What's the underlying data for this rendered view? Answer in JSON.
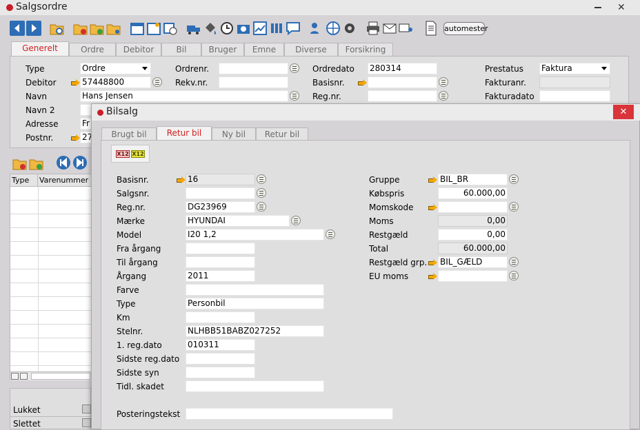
{
  "main_window": {
    "title": "Salgsordre",
    "toolbar": {
      "automester_label": "automester"
    },
    "tabs": [
      {
        "label": "Generelt",
        "active": true
      },
      {
        "label": "Ordre"
      },
      {
        "label": "Debitor"
      },
      {
        "label": "Bil"
      },
      {
        "label": "Bruger"
      },
      {
        "label": "Emne"
      },
      {
        "label": "Diverse"
      },
      {
        "label": "Forsikring"
      }
    ],
    "form": {
      "type_label": "Type",
      "type_value": "Ordre",
      "debitor_label": "Debitor",
      "debitor_value": "57448800",
      "navn_label": "Navn",
      "navn_value": "Hans Jensen",
      "navn2_label": "Navn 2",
      "navn2_value": "",
      "adresse_label": "Adresse",
      "adresse_value": "Fr",
      "postnr_label": "Postnr.",
      "postnr_value": "27",
      "ordrenr_label": "Ordrenr.",
      "ordrenr_value": "",
      "rekvnr_label": "Rekv.nr.",
      "rekvnr_value": "",
      "ordredato_label": "Ordredato",
      "ordredato_value": "280314",
      "basisnr_label": "Basisnr.",
      "basisnr_value": "",
      "regnr_label": "Reg.nr.",
      "regnr_value": "",
      "prestatus_label": "Prestatus",
      "prestatus_value": "Faktura",
      "fakturanr_label": "Fakturanr.",
      "fakturanr_value": "",
      "fakturadato_label": "Fakturadato",
      "fakturadato_value": ""
    },
    "grid": {
      "col_type": "Type",
      "col_varenummer": "Varenummer"
    },
    "status": {
      "lukket_label": "Lukket",
      "slettet_label": "Slettet"
    }
  },
  "dialog": {
    "title": "Bilsalg",
    "close_label": "✕",
    "tabs": [
      {
        "label": "Brugt bil"
      },
      {
        "label": "Retur bil",
        "active": true
      },
      {
        "label": "Ny bil"
      },
      {
        "label": "Retur bil"
      }
    ],
    "x12_a": "X12",
    "x12_b": "X12",
    "left": [
      {
        "label": "Basisnr.",
        "value": "16"
      },
      {
        "label": "Salgsnr.",
        "value": ""
      },
      {
        "label": "Reg.nr.",
        "value": "DG23969"
      },
      {
        "label": "Mærke",
        "value": "HYUNDAI"
      },
      {
        "label": "Model",
        "value": "I20 1,2"
      },
      {
        "label": "Fra årgang",
        "value": ""
      },
      {
        "label": "Til årgang",
        "value": ""
      },
      {
        "label": "Årgang",
        "value": "2011"
      },
      {
        "label": "Farve",
        "value": ""
      },
      {
        "label": "Type",
        "value": "Personbil"
      },
      {
        "label": "Km",
        "value": ""
      },
      {
        "label": "Stelnr.",
        "value": "NLHBB51BABZ027252"
      },
      {
        "label": "1. reg.dato",
        "value": "010311"
      },
      {
        "label": "Sidste reg.dato",
        "value": ""
      },
      {
        "label": "Sidste syn",
        "value": ""
      },
      {
        "label": "Tidl. skadet",
        "value": ""
      }
    ],
    "posteringstekst_label": "Posteringstekst",
    "posteringstekst_value": "",
    "right": [
      {
        "label": "Gruppe",
        "value": "BIL_BR"
      },
      {
        "label": "Købspris",
        "value": "60.000,00"
      },
      {
        "label": "Momskode",
        "value": ""
      },
      {
        "label": "Moms",
        "value": "0,00"
      },
      {
        "label": "Restgæld",
        "value": "0,00"
      },
      {
        "label": "Total",
        "value": "60.000,00"
      },
      {
        "label": "Restgæld grp.",
        "value": "BIL_GÆLD"
      },
      {
        "label": "EU moms",
        "value": ""
      }
    ]
  },
  "colors": {
    "accent_red": "#d02020",
    "title_blue": "#2d6db5",
    "dialog_close_red": "#d9343a"
  }
}
